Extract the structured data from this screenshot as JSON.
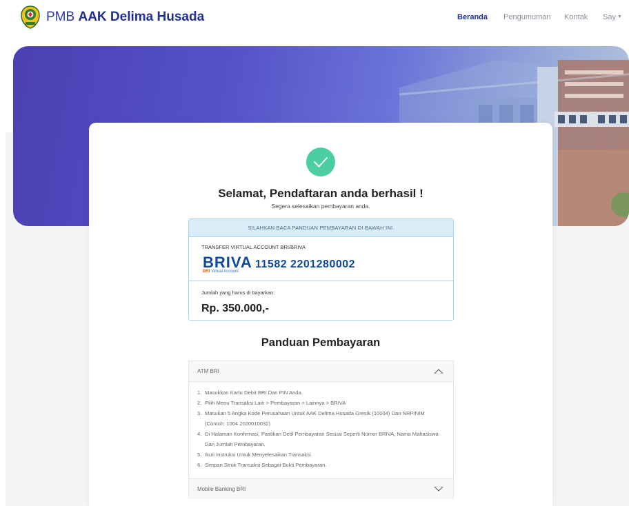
{
  "nav": {
    "brand_prefix": "PMB",
    "brand_name": "AAK Delima Husada",
    "items": [
      {
        "label": "Beranda",
        "active": true
      },
      {
        "label": "Pengumuman",
        "active": false
      },
      {
        "label": "Kontak",
        "active": false
      },
      {
        "label": "Say",
        "active": false
      }
    ]
  },
  "success": {
    "title": "Selamat, Pendaftaran anda berhasil !",
    "subtitle": "Segera selesaikan pembayaran anda."
  },
  "payment": {
    "notice": "SILAHKAN BACA PANDUAN PEMBAYARAN DI BAWAH INI.",
    "va_label": "TRANSFER VIRTUAL ACCOUNT BRI/BRIVA",
    "briva_logo": "BRIVA",
    "briva_sub_brand": "BRI",
    "briva_sub_text": "Virtual Account",
    "va_number": "11582 2201280002",
    "amount_label": "Jumlah yang harus di bayarkan:",
    "amount": "Rp. 350.000,-"
  },
  "guide": {
    "title": "Panduan Pembayaran",
    "sections": [
      {
        "title": "ATM BRI",
        "expanded": true,
        "steps": [
          "Masukkan Kartu Debit BRI Dan PIN Anda.",
          "Pilih Menu Transaksi Lain > Pembayaran > Lainnya > BRIVA",
          "Masukan 5 Angka Kode Perusahaan Untuk AAK Delima Husada Gresik (10004) Dan NRP/NIM (Contoh: 1004 2020010032)",
          "Di Halaman Konfirmasi, Pastikan Detil Pembayaran Sesuai Seperti Nomor BRIVA, Nama Mahasiswa Dan Jumlah Pembayaran.",
          "Ikuti Instruksi Untuk Menyelesaikan Transaksi.",
          "Simpan Struk Transaksi Sebagai Bukti Pembayaran."
        ]
      },
      {
        "title": "Mobile Banking BRI",
        "expanded": false,
        "steps": []
      }
    ]
  },
  "icons": {
    "logo": "campus-logo-icon",
    "success": "check-circle-icon",
    "expand": "chevron-up-icon",
    "collapse": "chevron-down-icon",
    "dropdown": "caret-down-icon"
  },
  "colors": {
    "brand": "#1f2f8f",
    "success": "#4ccfa0",
    "briva_blue": "#0c4a9d",
    "notice_bg": "#d9edf8",
    "notice_border": "#a9d5ea"
  }
}
